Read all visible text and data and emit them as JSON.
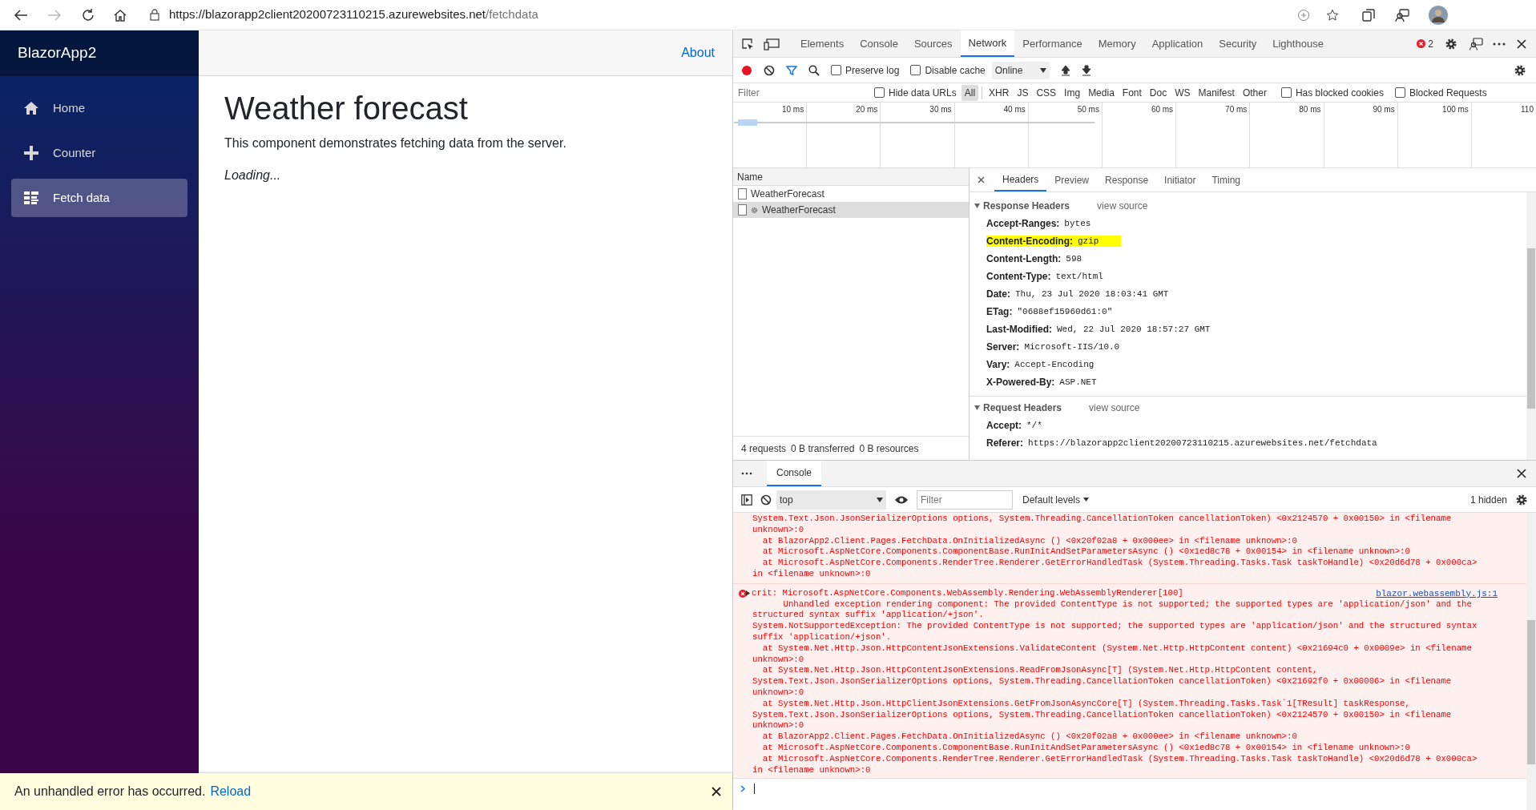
{
  "browser": {
    "url_host": "https://blazorapp2client20200723110215.azurewebsites.net",
    "url_path": "/fetchdata"
  },
  "app": {
    "brand": "BlazorApp2",
    "nav": [
      {
        "label": "Home",
        "selected": false
      },
      {
        "label": "Counter",
        "selected": false
      },
      {
        "label": "Fetch data",
        "selected": true
      }
    ],
    "top_link": "About",
    "heading": "Weather forecast",
    "intro": "This component demonstrates fetching data from the server.",
    "loading": "Loading...",
    "error_bar": {
      "message": "An unhandled error has occurred.",
      "link": "Reload"
    }
  },
  "devtools": {
    "tabs": [
      {
        "label": "Elements",
        "selected": false
      },
      {
        "label": "Console",
        "selected": false
      },
      {
        "label": "Sources",
        "selected": false
      },
      {
        "label": "Network",
        "selected": true
      },
      {
        "label": "Performance",
        "selected": false
      },
      {
        "label": "Memory",
        "selected": false
      },
      {
        "label": "Application",
        "selected": false
      },
      {
        "label": "Security",
        "selected": false
      },
      {
        "label": "Lighthouse",
        "selected": false
      }
    ],
    "error_count": "2",
    "network_toolbar": {
      "recording": true,
      "preserve_log": {
        "label": "Preserve log",
        "checked": false
      },
      "disable_cache": {
        "label": "Disable cache",
        "checked": false
      },
      "throttle": "Online"
    },
    "filter": {
      "placeholder": "Filter",
      "hide_data_urls": {
        "label": "Hide data URLs",
        "checked": false
      },
      "types": [
        {
          "label": "All",
          "selected": true
        },
        {
          "label": "XHR",
          "selected": false
        },
        {
          "label": "JS",
          "selected": false
        },
        {
          "label": "CSS",
          "selected": false
        },
        {
          "label": "Img",
          "selected": false
        },
        {
          "label": "Media",
          "selected": false
        },
        {
          "label": "Font",
          "selected": false
        },
        {
          "label": "Doc",
          "selected": false
        },
        {
          "label": "WS",
          "selected": false
        },
        {
          "label": "Manifest",
          "selected": false
        },
        {
          "label": "Other",
          "selected": false
        }
      ],
      "extra_checks": [
        {
          "label": "Has blocked cookies",
          "checked": false
        },
        {
          "label": "Blocked Requests",
          "checked": false
        }
      ]
    },
    "timeline": {
      "ticks": [
        "10 ms",
        "20 ms",
        "30 ms",
        "40 ms",
        "50 ms",
        "60 ms",
        "70 ms",
        "80 ms",
        "90 ms",
        "100 ms",
        "110"
      ]
    },
    "requests": {
      "column": "Name",
      "rows": [
        {
          "name": "WeatherForecast",
          "kind": "document",
          "selected": false
        },
        {
          "name": "WeatherForecast",
          "kind": "preflight",
          "selected": true
        }
      ],
      "summary": [
        "4 requests",
        "0 B transferred",
        "0 B resources"
      ]
    },
    "detail_tabs": [
      {
        "label": "Headers",
        "selected": true
      },
      {
        "label": "Preview",
        "selected": false
      },
      {
        "label": "Response",
        "selected": false
      },
      {
        "label": "Initiator",
        "selected": false
      },
      {
        "label": "Timing",
        "selected": false
      }
    ],
    "sections": [
      {
        "title": "Response Headers",
        "link": "view source",
        "expanded": true,
        "headers": [
          {
            "name": "Accept-Ranges:",
            "value": "bytes",
            "highlighted": false
          },
          {
            "name": "Content-Encoding:",
            "value": "gzip",
            "highlighted": true
          },
          {
            "name": "Content-Length:",
            "value": "598",
            "highlighted": false
          },
          {
            "name": "Content-Type:",
            "value": "text/html",
            "highlighted": false
          },
          {
            "name": "Date:",
            "value": "Thu, 23 Jul 2020 18:03:41 GMT",
            "highlighted": false
          },
          {
            "name": "ETag:",
            "value": "\"0688ef15960d61:0\"",
            "highlighted": false
          },
          {
            "name": "Last-Modified:",
            "value": "Wed, 22 Jul 2020 18:57:27 GMT",
            "highlighted": false
          },
          {
            "name": "Server:",
            "value": "Microsoft-IIS/10.0",
            "highlighted": false
          },
          {
            "name": "Vary:",
            "value": "Accept-Encoding",
            "highlighted": false
          },
          {
            "name": "X-Powered-By:",
            "value": "ASP.NET",
            "highlighted": false
          }
        ]
      },
      {
        "title": "Request Headers",
        "link": "view source",
        "expanded": true,
        "headers": [
          {
            "name": "Accept:",
            "value": "*/*",
            "highlighted": false
          },
          {
            "name": "Referer:",
            "value": "https://blazorapp2client20200723110215.azurewebsites.net/fetchdata",
            "highlighted": false
          }
        ]
      }
    ],
    "drawer": {
      "tabs": [
        {
          "label": "Console",
          "selected": true
        }
      ],
      "context": "top",
      "filter_placeholder": "Filter",
      "levels": "Default levels",
      "hidden": "1 hidden",
      "messages": [
        {
          "kind": "error",
          "lines": [
            "System.Text.Json.JsonSerializerOptions options, System.Threading.CancellationToken cancellationToken) <0x2124570 + 0x00150> in <filename",
            "unknown>:0",
            "  at BlazorApp2.Client.Pages.FetchData.OnInitializedAsync () <0x20f02a8 + 0x000ee> in <filename unknown>:0",
            "  at Microsoft.AspNetCore.Components.ComponentBase.RunInitAndSetParametersAsync () <0x1ed8c78 + 0x00154> in <filename unknown>:0",
            "  at Microsoft.AspNetCore.Components.RenderTree.Renderer.GetErrorHandledTask (System.Threading.Tasks.Task taskToHandle) <0x20d6d78 + 0x000ca>",
            "in <filename unknown>:0"
          ]
        },
        {
          "kind": "error",
          "collapsed": true,
          "source": "blazor.webassembly.js:1",
          "lines": [
            "crit: Microsoft.AspNetCore.Components.WebAssembly.Rendering.WebAssemblyRenderer[100]",
            "      Unhandled exception rendering component: The provided ContentType is not supported; the supported types are 'application/json' and the",
            "structured syntax suffix 'application/+json'.",
            "System.NotSupportedException: The provided ContentType is not supported; the supported types are 'application/json' and the structured syntax",
            "suffix 'application/+json'.",
            "  at System.Net.Http.Json.HttpContentJsonExtensions.ValidateContent (System.Net.Http.HttpContent content) <0x21694c0 + 0x0009e> in <filename",
            "unknown>:0",
            "  at System.Net.Http.Json.HttpContentJsonExtensions.ReadFromJsonAsync[T] (System.Net.Http.HttpContent content,",
            "System.Text.Json.JsonSerializerOptions options, System.Threading.CancellationToken cancellationToken) <0x21692f0 + 0x00006> in <filename",
            "unknown>:0",
            "  at System.Net.Http.Json.HttpClientJsonExtensions.GetFromJsonAsyncCore[T] (System.Threading.Tasks.Task`1[TResult] taskResponse,",
            "System.Text.Json.JsonSerializerOptions options, System.Threading.CancellationToken cancellationToken) <0x2124570 + 0x00150> in <filename",
            "unknown>:0",
            "  at BlazorApp2.Client.Pages.FetchData.OnInitializedAsync () <0x20f02a8 + 0x000ee> in <filename unknown>:0",
            "  at Microsoft.AspNetCore.Components.ComponentBase.RunInitAndSetParametersAsync () <0x1ed8c78 + 0x00154> in <filename unknown>:0",
            "  at Microsoft.AspNetCore.Components.RenderTree.Renderer.GetErrorHandledTask (System.Threading.Tasks.Task taskToHandle) <0x20d6d78 + 0x000ca>",
            "in <filename unknown>:0"
          ]
        }
      ]
    }
  }
}
